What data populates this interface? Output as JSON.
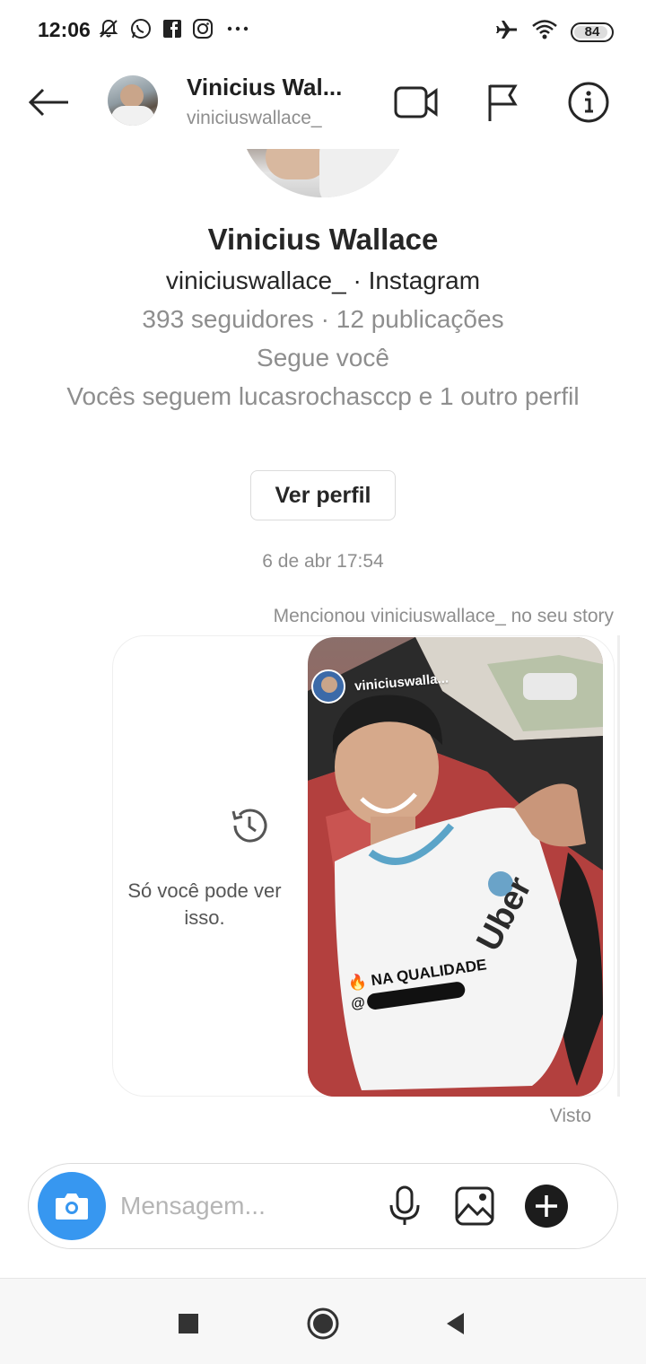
{
  "status_bar": {
    "time": "12:06",
    "left_icons": [
      "mute-bell-icon",
      "whatsapp-icon",
      "facebook-icon",
      "instagram-icon",
      "more-dots-icon"
    ],
    "right_icons": [
      "airplane-icon",
      "wifi-icon"
    ],
    "battery": "84"
  },
  "header": {
    "name": "Vinicius Wal...",
    "username": "viniciuswallace_",
    "icons": [
      "back-arrow-icon",
      "video-call-icon",
      "flag-icon",
      "info-icon"
    ]
  },
  "profile": {
    "name": "Vinicius Wallace",
    "line_account": "viniciuswallace_ · Instagram",
    "line_stats": "393 seguidores · 12 publicações",
    "line_follows": "Segue você",
    "line_mutual": "Vocês seguem lucasrochasccp e 1 outro perfil",
    "view_profile_label": "Ver perfil"
  },
  "thread": {
    "timestamp": "6 de abr 17:54",
    "mention_note": "Mencionou viniciuswallace_ no seu story",
    "private_note": "Só você pode ver isso.",
    "story_user": "viniciuswalla...",
    "story_caption_1": "🔥 NA QUALIDADE",
    "story_caption_2": "@",
    "seen": "Visto"
  },
  "composer": {
    "placeholder": "Mensagem...",
    "icons": [
      "camera-icon",
      "microphone-icon",
      "gallery-icon",
      "add-icon"
    ]
  },
  "colors": {
    "accent": "#3797f0",
    "text": "#262626",
    "muted": "#8e8e8e"
  }
}
